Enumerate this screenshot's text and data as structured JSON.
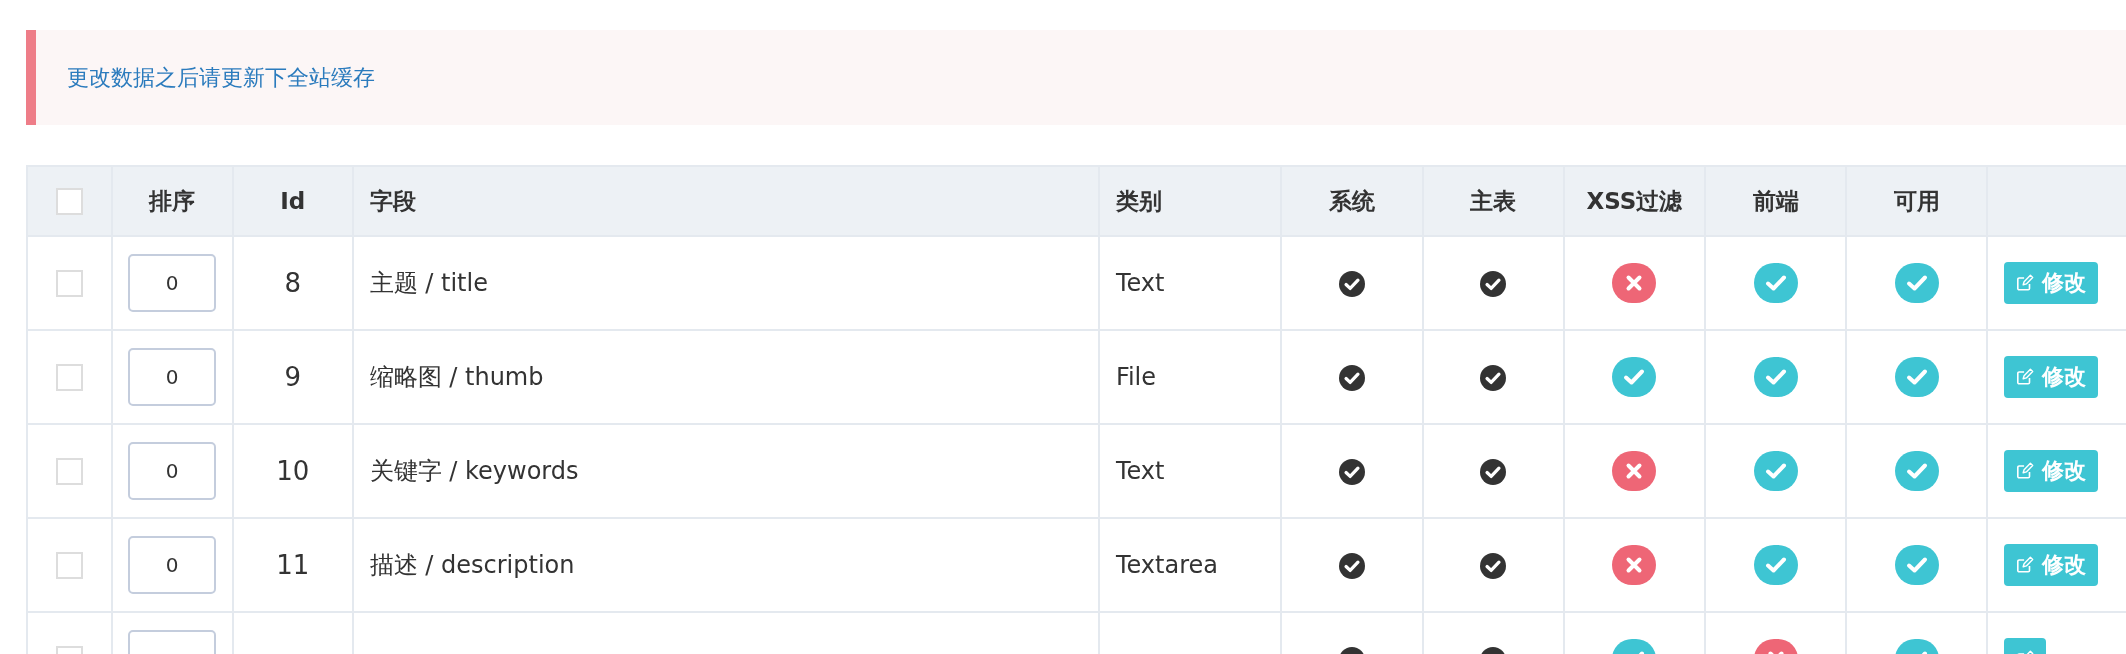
{
  "alert": {
    "text": "更改数据之后请更新下全站缓存"
  },
  "table": {
    "select_all": {
      "checked": false
    },
    "columns": [
      {
        "label": "排序",
        "kind": "order"
      },
      {
        "label": "Id",
        "kind": "id"
      },
      {
        "label": "字段",
        "kind": "field"
      },
      {
        "label": "类别",
        "kind": "type"
      },
      {
        "label": "系统",
        "kind": "flag_plain"
      },
      {
        "label": "主表",
        "kind": "flag_plain"
      },
      {
        "label": "XSS过滤",
        "kind": "flag_badge"
      },
      {
        "label": "前端",
        "kind": "flag_badge"
      },
      {
        "label": "可用",
        "kind": "flag_badge"
      },
      {
        "kind": "action"
      }
    ],
    "rows": [
      {
        "checked": false,
        "order": "0",
        "id": "8",
        "field": "主题 / title",
        "type": "Text",
        "flags": [
          true,
          true,
          false,
          true,
          true
        ],
        "action": "修改"
      },
      {
        "checked": false,
        "order": "0",
        "id": "9",
        "field": "缩略图 / thumb",
        "type": "File",
        "flags": [
          true,
          true,
          true,
          true,
          true
        ],
        "action": "修改"
      },
      {
        "checked": false,
        "order": "0",
        "id": "10",
        "field": "关键字 / keywords",
        "type": "Text",
        "flags": [
          true,
          true,
          false,
          true,
          true
        ],
        "action": "修改"
      },
      {
        "checked": false,
        "order": "0",
        "id": "11",
        "field": "描述 / description",
        "type": "Textarea",
        "flags": [
          true,
          true,
          false,
          true,
          true
        ],
        "action": "修改"
      },
      {
        "checked": false,
        "flags": [
          true,
          true,
          true,
          false,
          true
        ]
      }
    ]
  }
}
